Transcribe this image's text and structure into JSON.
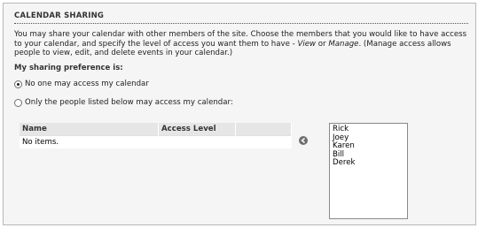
{
  "section": {
    "title": "CALENDAR SHARING",
    "description_part1": "You may share your calendar with other members of the site. Choose the members that you would like to have access to your calendar, and specify the level of access you want them to have - ",
    "view_word": "View",
    "or_word": " or ",
    "manage_word": "Manage",
    "description_part2": ". (Manage access allows people to view, edit, and delete events in your calendar.)"
  },
  "preference": {
    "heading": "My sharing preference is:",
    "options": [
      {
        "label": "No one may access my calendar",
        "selected": true
      },
      {
        "label": "Only the people listed below may access my calendar:",
        "selected": false
      }
    ]
  },
  "table": {
    "columns": [
      "Name",
      "Access Level",
      ""
    ],
    "empty_text": "No items."
  },
  "add_button": {
    "icon": "arrow-left-icon"
  },
  "members": [
    "Rick",
    "Joey",
    "Karen",
    "Bill",
    "Derek"
  ]
}
